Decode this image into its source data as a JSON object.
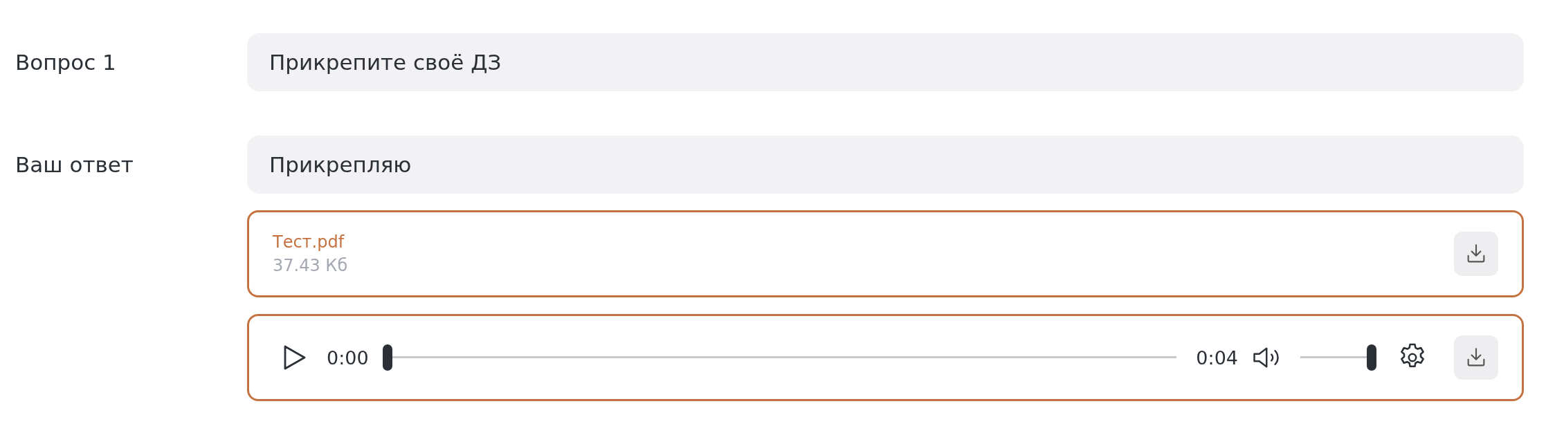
{
  "rows": [
    {
      "label": "Вопрос 1",
      "value": "Прикрепите своё ДЗ"
    },
    {
      "label": "Ваш ответ",
      "value": "Прикрепляю"
    }
  ],
  "file": {
    "name": "Тест.pdf",
    "size": "37.43 Кб"
  },
  "audio": {
    "current": "0:00",
    "duration": "0:04",
    "progress": {
      "level": 0
    },
    "volume": {
      "level": 1
    }
  }
}
